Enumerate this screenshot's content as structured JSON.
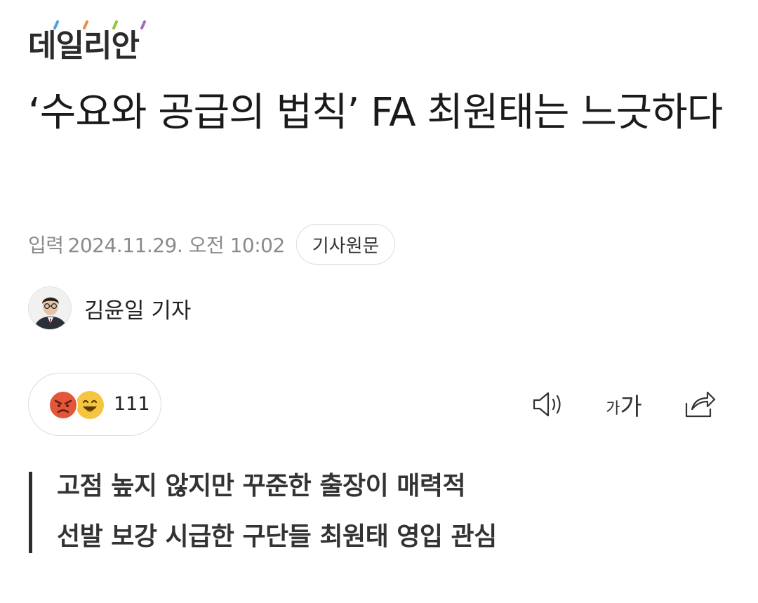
{
  "brand": {
    "logo_text": "데일리안",
    "dot_colors": [
      "#4aa3df",
      "#f08a4b",
      "#8cc63e",
      "#a66bbe"
    ]
  },
  "article": {
    "headline": "‘수요와 공급의 법칙’ FA 최원태는 느긋하다",
    "date_label": "입력",
    "date_value": "2024.11.29. 오전 10:02",
    "original_button": "기사원문",
    "reporter": {
      "name": "김윤일 기자",
      "avatar": "reporter-photo"
    }
  },
  "reactions": {
    "icons": [
      "angry-face",
      "laughing-face"
    ],
    "count": "111"
  },
  "toolbar": {
    "speaker_icon": "speaker-icon",
    "font_small": "가",
    "font_large": "가",
    "share_icon": "share-icon"
  },
  "summary": {
    "lines": [
      "고점 높지 않지만 꾸준한 출장이 매력적",
      "선발 보강 시급한 구단들 최원태 영입 관심"
    ]
  },
  "colors": {
    "text": "#1a1a1a",
    "muted": "#8a8a8a",
    "border": "#dcdcdc",
    "angry": "#e2563a",
    "laugh": "#f5c542"
  }
}
